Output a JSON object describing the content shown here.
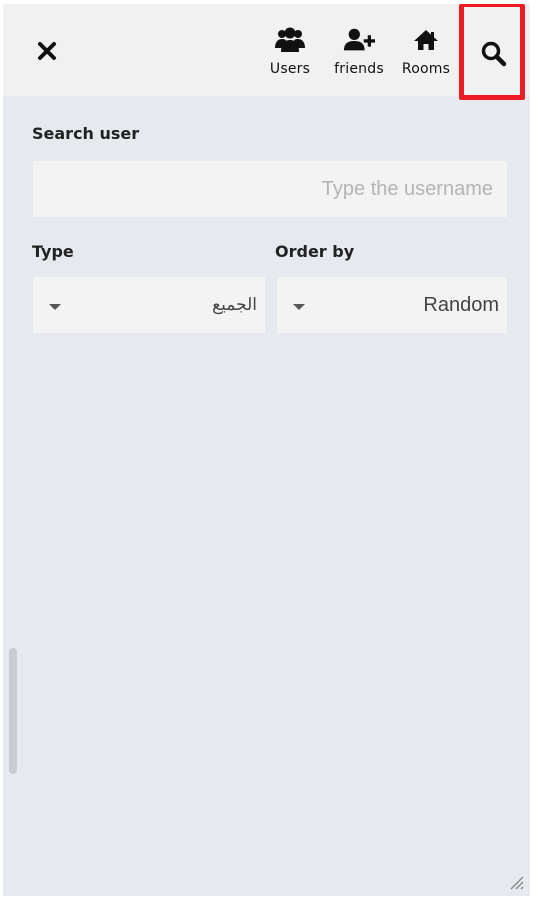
{
  "toolbar": {
    "close_icon": "close-icon",
    "items": [
      {
        "label": "Users",
        "icon": "users-icon"
      },
      {
        "label": "friends",
        "icon": "add-friend-icon"
      },
      {
        "label": "Rooms",
        "icon": "home-icon"
      },
      {
        "label": "",
        "icon": "search-icon"
      }
    ],
    "highlight_color": "#ee1c25"
  },
  "search": {
    "label": "Search user",
    "placeholder": "Type the username",
    "value": ""
  },
  "filters": {
    "type_label": "Type",
    "type_value": "الجميع",
    "order_label": "Order by",
    "order_value": "Random"
  },
  "colors": {
    "panel_bg": "#e6e9ed",
    "topbar_bg": "#f1f1f1",
    "field_bg": "#f3f3f3"
  }
}
